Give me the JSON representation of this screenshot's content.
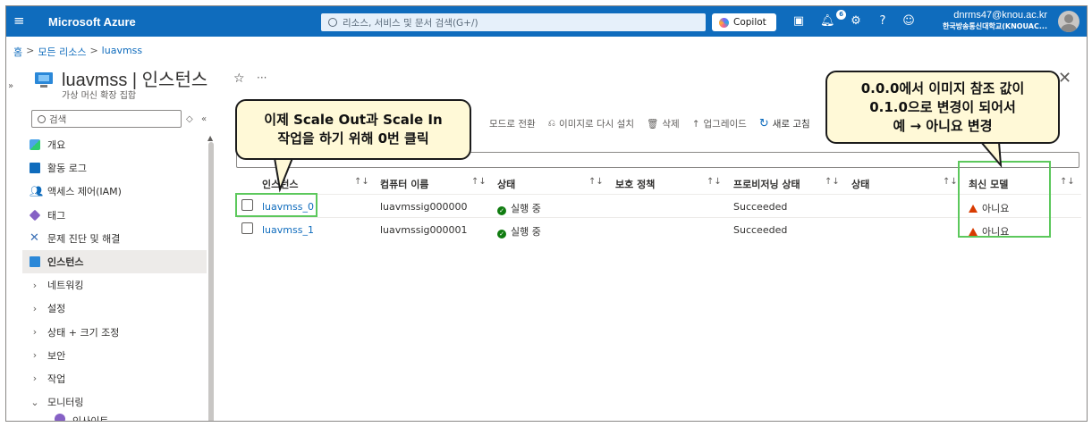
{
  "topbar": {
    "brand": "Microsoft Azure",
    "search_placeholder": "리소스, 서비스 및 문서 검색(G+/)",
    "copilot_label": "Copilot",
    "notification_count": "6",
    "user_email": "dnrms47@knou.ac.kr",
    "user_org": "한국방송통신대학교(KNOUAC..."
  },
  "breadcrumb": {
    "home": "홈",
    "all_resources": "모든 리소스",
    "current": "luavmss"
  },
  "header": {
    "title": "luavmss | 인스턴스",
    "subtitle": "가상 머신 확장 집합"
  },
  "sidebar": {
    "search_placeholder": "검색",
    "items": [
      {
        "label": "개요",
        "icon": "overview-icon"
      },
      {
        "label": "활동 로그",
        "icon": "activity-log-icon"
      },
      {
        "label": "액세스 제어(IAM)",
        "icon": "iam-icon"
      },
      {
        "label": "태그",
        "icon": "tag-icon"
      },
      {
        "label": "문제 진단 및 해결",
        "icon": "diagnose-icon"
      },
      {
        "label": "인스턴스",
        "icon": "instances-icon",
        "active": true
      },
      {
        "label": "네트워킹",
        "expand": "collapsed"
      },
      {
        "label": "설정",
        "expand": "collapsed"
      },
      {
        "label": "상태 + 크기 조정",
        "expand": "collapsed"
      },
      {
        "label": "보안",
        "expand": "collapsed"
      },
      {
        "label": "작업",
        "expand": "collapsed"
      },
      {
        "label": "모니터링",
        "expand": "expanded"
      },
      {
        "label": "인사이트",
        "icon": "insights-icon"
      }
    ]
  },
  "toolbar": {
    "switch_mode": "모드로 전환",
    "reimage": "이미지로 다시 설치",
    "delete": "삭제",
    "upgrade": "업그레이드",
    "refresh": "새로 고침"
  },
  "table": {
    "columns": [
      "인스턴스",
      "컴퓨터 이름",
      "상태",
      "보호 정책",
      "프로비저닝 상태",
      "상태",
      "최신 모델"
    ],
    "rows": [
      {
        "instance": "luavmss_0",
        "computer_name": "luavmssig000000",
        "status": "실행 중",
        "protection": "",
        "provisioning": "Succeeded",
        "health": "",
        "latest_model": "아니요"
      },
      {
        "instance": "luavmss_1",
        "computer_name": "luavmssig000001",
        "status": "실행 중",
        "protection": "",
        "provisioning": "Succeeded",
        "health": "",
        "latest_model": "아니요"
      }
    ]
  },
  "callouts": {
    "left": [
      "이제 Scale Out과 Scale In",
      "작업을 하기 위해 0번 클릭"
    ],
    "right": [
      "0.0.0에서 이미지 참조 값이",
      "0.1.0으로 변경이 되어서",
      "예 → 아니요 변경"
    ]
  },
  "colors": {
    "azure_blue": "#0f6cbd",
    "highlight_green": "#5cc85c",
    "callout_bg": "#fff9d7",
    "running_green": "#107c10",
    "warning_orange": "#d83b01"
  }
}
